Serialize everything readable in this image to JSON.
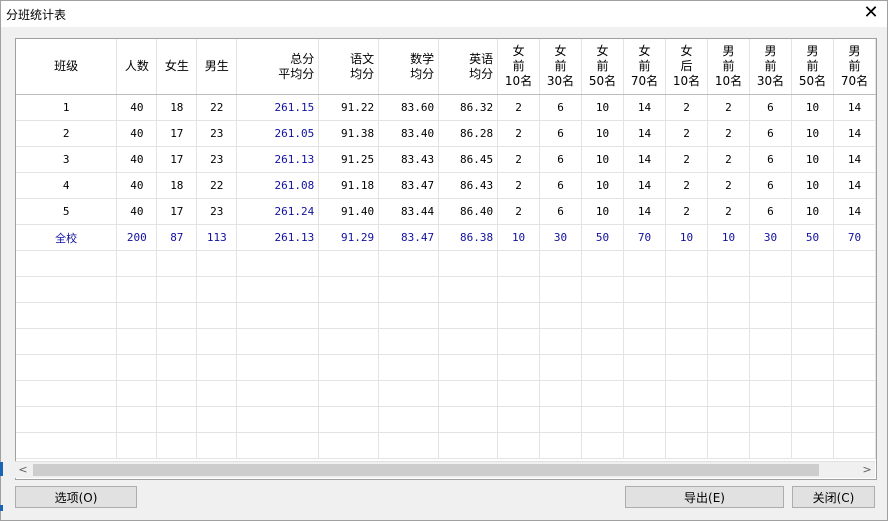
{
  "window": {
    "title": "分班统计表"
  },
  "headers": [
    {
      "label": "班级",
      "align": "center"
    },
    {
      "label": "人数",
      "align": "center"
    },
    {
      "label": "女生",
      "align": "center"
    },
    {
      "label": "男生",
      "align": "center"
    },
    {
      "label": "总分\n平均分",
      "align": "right"
    },
    {
      "label": "语文\n均分",
      "align": "right"
    },
    {
      "label": "数学\n均分",
      "align": "right"
    },
    {
      "label": "英语\n均分",
      "align": "right"
    },
    {
      "label": "女\n前\n10名",
      "align": "center"
    },
    {
      "label": "女\n前\n30名",
      "align": "center"
    },
    {
      "label": "女\n前\n50名",
      "align": "center"
    },
    {
      "label": "女\n前\n70名",
      "align": "center"
    },
    {
      "label": "女\n后\n10名",
      "align": "center"
    },
    {
      "label": "男\n前\n10名",
      "align": "center"
    },
    {
      "label": "男\n前\n30名",
      "align": "center"
    },
    {
      "label": "男\n前\n50名",
      "align": "center"
    },
    {
      "label": "男\n前\n70名",
      "align": "center"
    }
  ],
  "rows": [
    [
      "1",
      "40",
      "18",
      "22",
      "261.15",
      "91.22",
      "83.60",
      "86.32",
      "2",
      "6",
      "10",
      "14",
      "2",
      "2",
      "6",
      "10",
      "14"
    ],
    [
      "2",
      "40",
      "17",
      "23",
      "261.05",
      "91.38",
      "83.40",
      "86.28",
      "2",
      "6",
      "10",
      "14",
      "2",
      "2",
      "6",
      "10",
      "14"
    ],
    [
      "3",
      "40",
      "17",
      "23",
      "261.13",
      "91.25",
      "83.43",
      "86.45",
      "2",
      "6",
      "10",
      "14",
      "2",
      "2",
      "6",
      "10",
      "14"
    ],
    [
      "4",
      "40",
      "18",
      "22",
      "261.08",
      "91.18",
      "83.47",
      "86.43",
      "2",
      "6",
      "10",
      "14",
      "2",
      "2",
      "6",
      "10",
      "14"
    ],
    [
      "5",
      "40",
      "17",
      "23",
      "261.24",
      "91.40",
      "83.44",
      "86.40",
      "2",
      "6",
      "10",
      "14",
      "2",
      "2",
      "6",
      "10",
      "14"
    ]
  ],
  "total_row": [
    "全校",
    "200",
    "87",
    "113",
    "261.13",
    "91.29",
    "83.47",
    "86.38",
    "10",
    "30",
    "50",
    "70",
    "10",
    "10",
    "30",
    "50",
    "70"
  ],
  "buttons": {
    "options": "选项(O)",
    "export": "导出(E)",
    "close": "关闭(C)"
  },
  "scroll": {
    "left_arrow": "<",
    "right_arrow": ">"
  },
  "icons": {
    "close": "close-icon"
  }
}
